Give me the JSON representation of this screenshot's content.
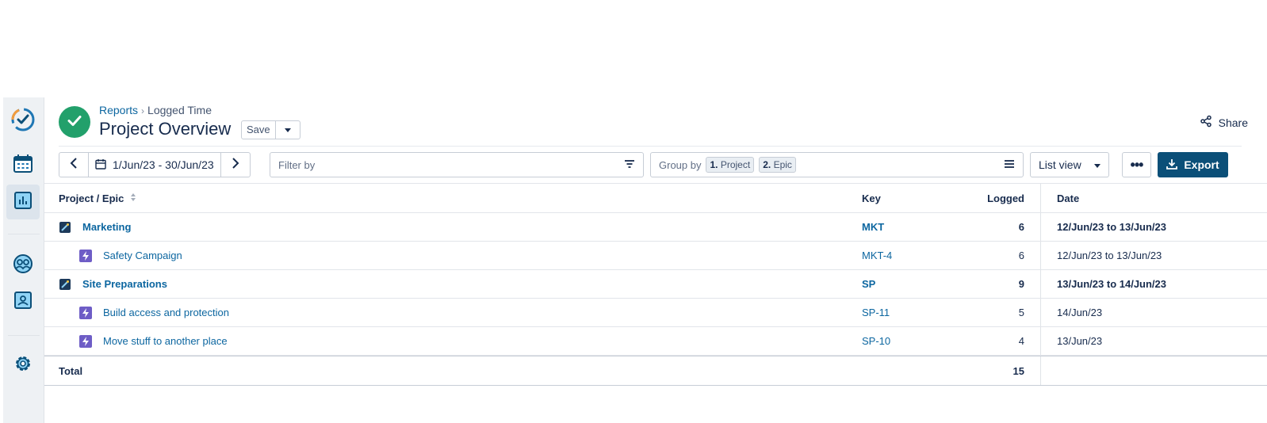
{
  "breadcrumb": {
    "root": "Reports",
    "current": "Logged Time"
  },
  "page_title": "Project Overview",
  "save_label": "Save",
  "share_label": "Share",
  "date_range": "1/Jun/23 - 30/Jun/23",
  "filter_placeholder": "Filter by",
  "group_by": {
    "label": "Group by",
    "chips": [
      {
        "num": "1.",
        "name": "Project"
      },
      {
        "num": "2.",
        "name": "Epic"
      }
    ]
  },
  "view_select": "List view",
  "more_label": "•••",
  "export_label": "Export",
  "table": {
    "headers": {
      "project": "Project / Epic",
      "key": "Key",
      "logged": "Logged",
      "date": "Date"
    },
    "rows": [
      {
        "name": "Marketing",
        "key": "MKT",
        "logged": "6",
        "date": "12/Jun/23 to 13/Jun/23",
        "level": "project"
      },
      {
        "name": "Safety Campaign",
        "key": "MKT-4",
        "logged": "6",
        "date": "12/Jun/23 to 13/Jun/23",
        "level": "epic"
      },
      {
        "name": "Site Preparations",
        "key": "SP",
        "logged": "9",
        "date": "13/Jun/23 to 14/Jun/23",
        "level": "project"
      },
      {
        "name": "Build access and protection",
        "key": "SP-11",
        "logged": "5",
        "date": "14/Jun/23",
        "level": "epic"
      },
      {
        "name": "Move stuff to another place",
        "key": "SP-10",
        "logged": "4",
        "date": "13/Jun/23",
        "level": "epic"
      }
    ],
    "total": {
      "label": "Total",
      "logged": "15"
    }
  },
  "colors": {
    "accent": "#0b4f78",
    "status": "#22a06b",
    "epic": "#6e5dc6",
    "link": "#0c66a0"
  },
  "icons": [
    "app-logo-icon",
    "calendar-icon",
    "reports-icon",
    "team-icon",
    "user-card-icon",
    "gear-icon",
    "check-icon",
    "share-icon",
    "chevron-left-icon",
    "chevron-right-icon",
    "filter-icon",
    "menu-icon",
    "caret-down-icon",
    "download-icon",
    "sort-icon",
    "project-icon",
    "epic-icon"
  ]
}
